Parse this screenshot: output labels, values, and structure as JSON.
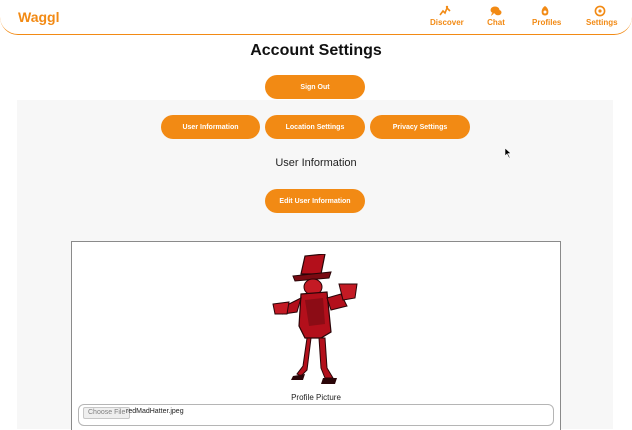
{
  "header": {
    "logo": "Waggl",
    "nav": [
      {
        "label": "Discover",
        "icon": "discover-icon"
      },
      {
        "label": "Chat",
        "icon": "chat-icon"
      },
      {
        "label": "Profiles",
        "icon": "profiles-icon"
      },
      {
        "label": "Settings",
        "icon": "settings-icon"
      }
    ]
  },
  "page": {
    "title": "Account Settings",
    "sign_out_label": "Sign Out",
    "tabs": [
      {
        "label": "User Information"
      },
      {
        "label": "Location Settings"
      },
      {
        "label": "Privacy Settings"
      }
    ],
    "section_title": "User Information",
    "edit_button_label": "Edit User Information"
  },
  "profile_card": {
    "picture_label": "Profile Picture",
    "file_button_label": "Choose File",
    "file_name": "redMadHatter.jpeg"
  },
  "colors": {
    "accent": "#f28a14",
    "picture_red": "#b30f1b"
  }
}
